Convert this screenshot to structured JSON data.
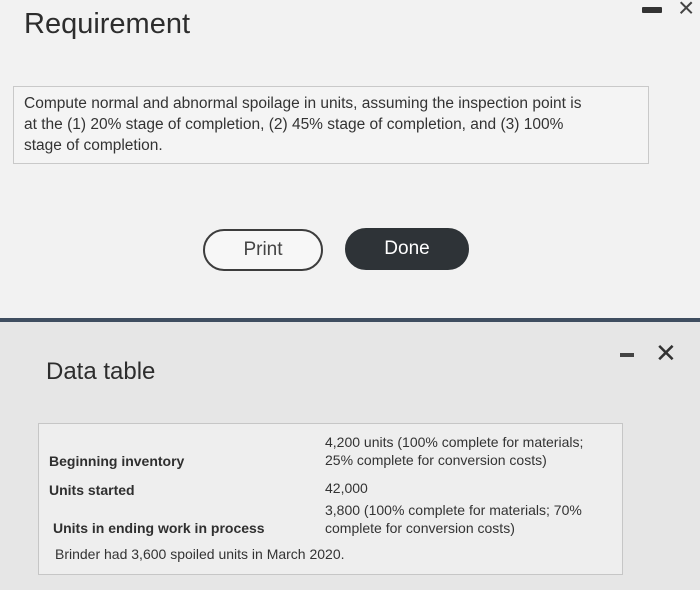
{
  "requirement_dialog": {
    "title": "Requirement",
    "text_line1": "Compute normal and abnormal spoilage in units, assuming the inspection point is",
    "text_line2": "at the (1) 20% stage of completion, (2) 45% stage of completion, and (3) 100%",
    "text_line3": "stage of completion.",
    "print_label": "Print",
    "done_label": "Done",
    "close_glyph": "×",
    "minimize_icon": "minimize-icon"
  },
  "data_table_dialog": {
    "title": "Data table",
    "close_glyph": "✕",
    "rows": [
      {
        "label": "Beginning inventory",
        "value_line1": "4,200 units (100% complete for materials;",
        "value_line2": "25% complete for conversion costs)"
      },
      {
        "label": "Units started",
        "value_line1": "42,000"
      },
      {
        "label": "Units in ending work in process",
        "value_line1": "3,800 (100% complete for materials; 70%",
        "value_line2": "complete for conversion costs)"
      }
    ],
    "note": "Brinder had 3,600 spoiled units in March 2020."
  }
}
